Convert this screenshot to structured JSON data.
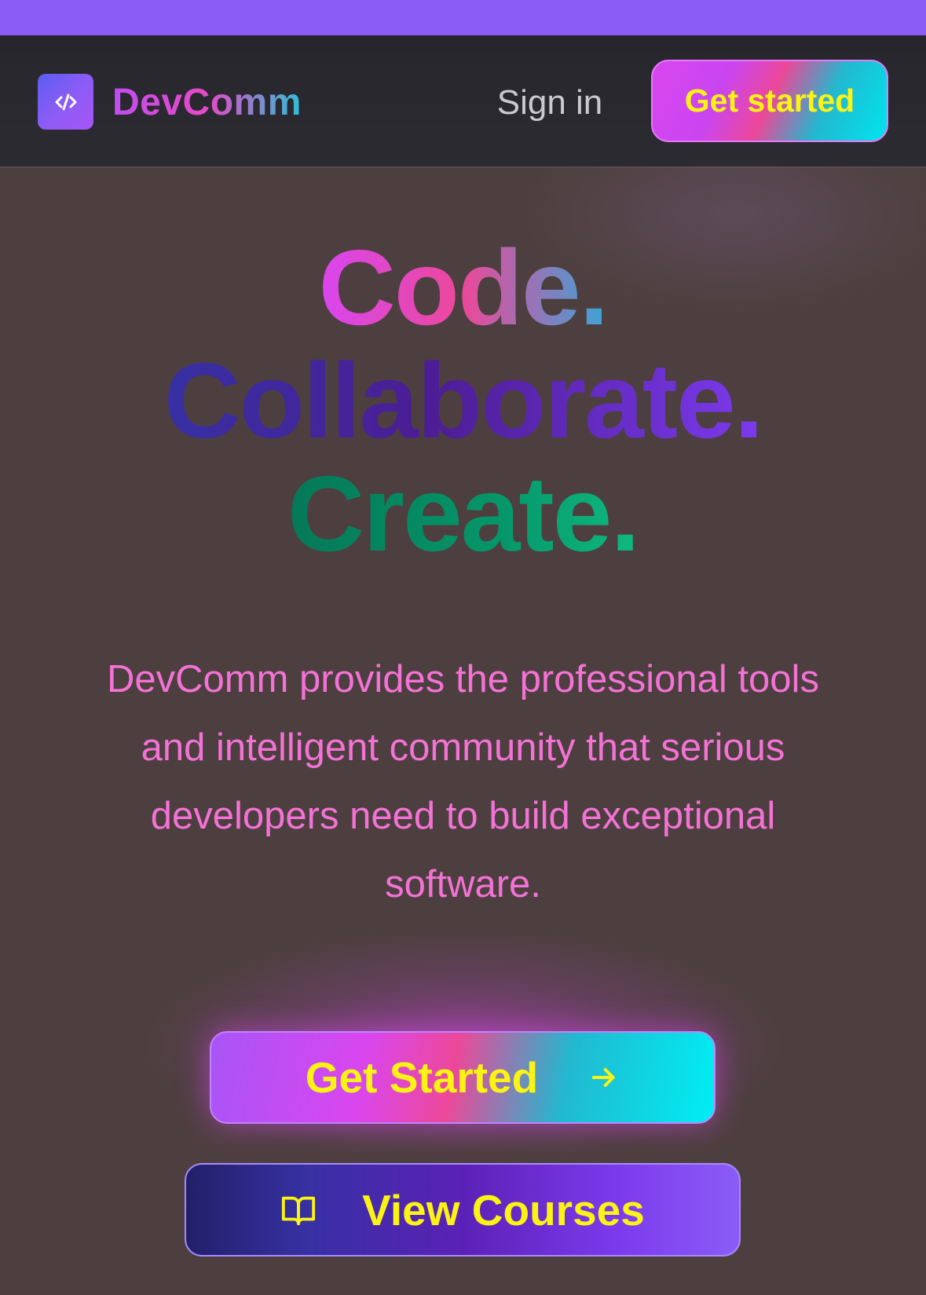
{
  "brand": {
    "name": "DevComm",
    "logo_icon": "code-icon"
  },
  "nav": {
    "sign_in_label": "Sign in",
    "get_started_label": "Get started"
  },
  "hero": {
    "line1": "Code.",
    "line2": "Collaborate.",
    "line3": "Create.",
    "description": "DevComm provides the professional tools and intelligent community that serious developers need to build exceptional software."
  },
  "cta": {
    "primary_label": "Get Started",
    "primary_icon": "arrow-right-icon",
    "secondary_label": "View Courses",
    "secondary_icon": "book-open-icon"
  },
  "colors": {
    "accent": "#8b5cf6",
    "button_text": "#faf314",
    "description_text": "#f472d6",
    "background": "#4d3f3f"
  }
}
